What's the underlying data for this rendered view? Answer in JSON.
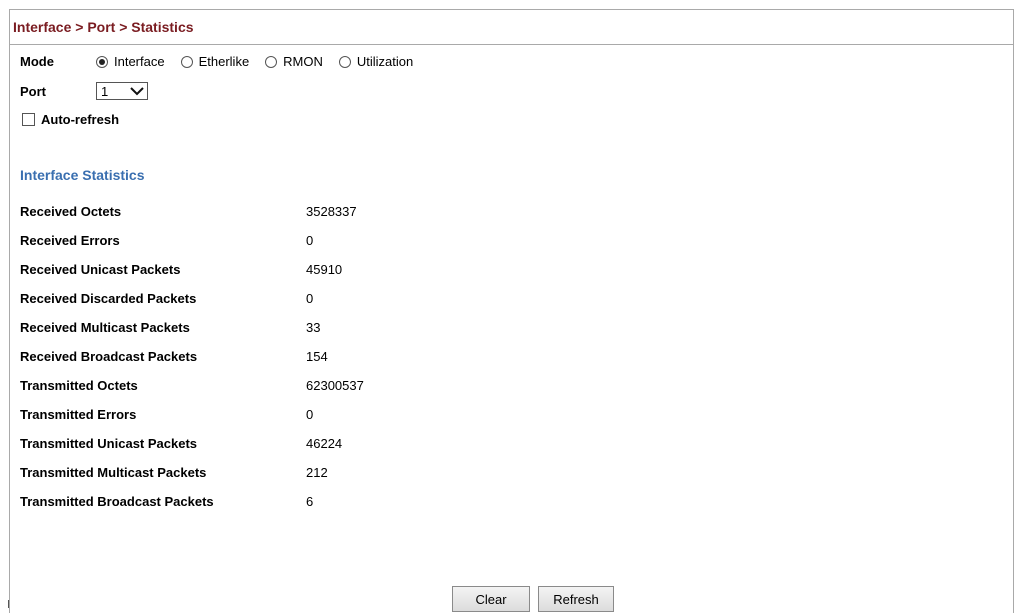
{
  "header": {
    "title": "Interface > Port > Statistics"
  },
  "mode": {
    "label": "Mode",
    "options": [
      {
        "label": "Interface",
        "checked": true
      },
      {
        "label": "Etherlike",
        "checked": false
      },
      {
        "label": "RMON",
        "checked": false
      },
      {
        "label": "Utilization",
        "checked": false
      }
    ]
  },
  "port": {
    "label": "Port",
    "selected": "1"
  },
  "auto_refresh": {
    "label": "Auto-refresh",
    "checked": false
  },
  "section": {
    "heading": "Interface Statistics"
  },
  "stats": [
    {
      "label": "Received Octets",
      "value": "3528337"
    },
    {
      "label": "Received Errors",
      "value": "0"
    },
    {
      "label": "Received Unicast Packets",
      "value": "45910"
    },
    {
      "label": "Received Discarded Packets",
      "value": "0"
    },
    {
      "label": "Received Multicast Packets",
      "value": "33"
    },
    {
      "label": "Received Broadcast Packets",
      "value": "154"
    },
    {
      "label": "Transmitted Octets",
      "value": "62300537"
    },
    {
      "label": "Transmitted Errors",
      "value": "0"
    },
    {
      "label": "Transmitted Unicast Packets",
      "value": "46224"
    },
    {
      "label": "Transmitted Multicast Packets",
      "value": "212"
    },
    {
      "label": "Transmitted Broadcast Packets",
      "value": "6"
    }
  ],
  "buttons": {
    "clear": "Clear",
    "refresh": "Refresh"
  },
  "colors": {
    "title": "#7a1c21",
    "section_heading": "#3a6fb0"
  }
}
